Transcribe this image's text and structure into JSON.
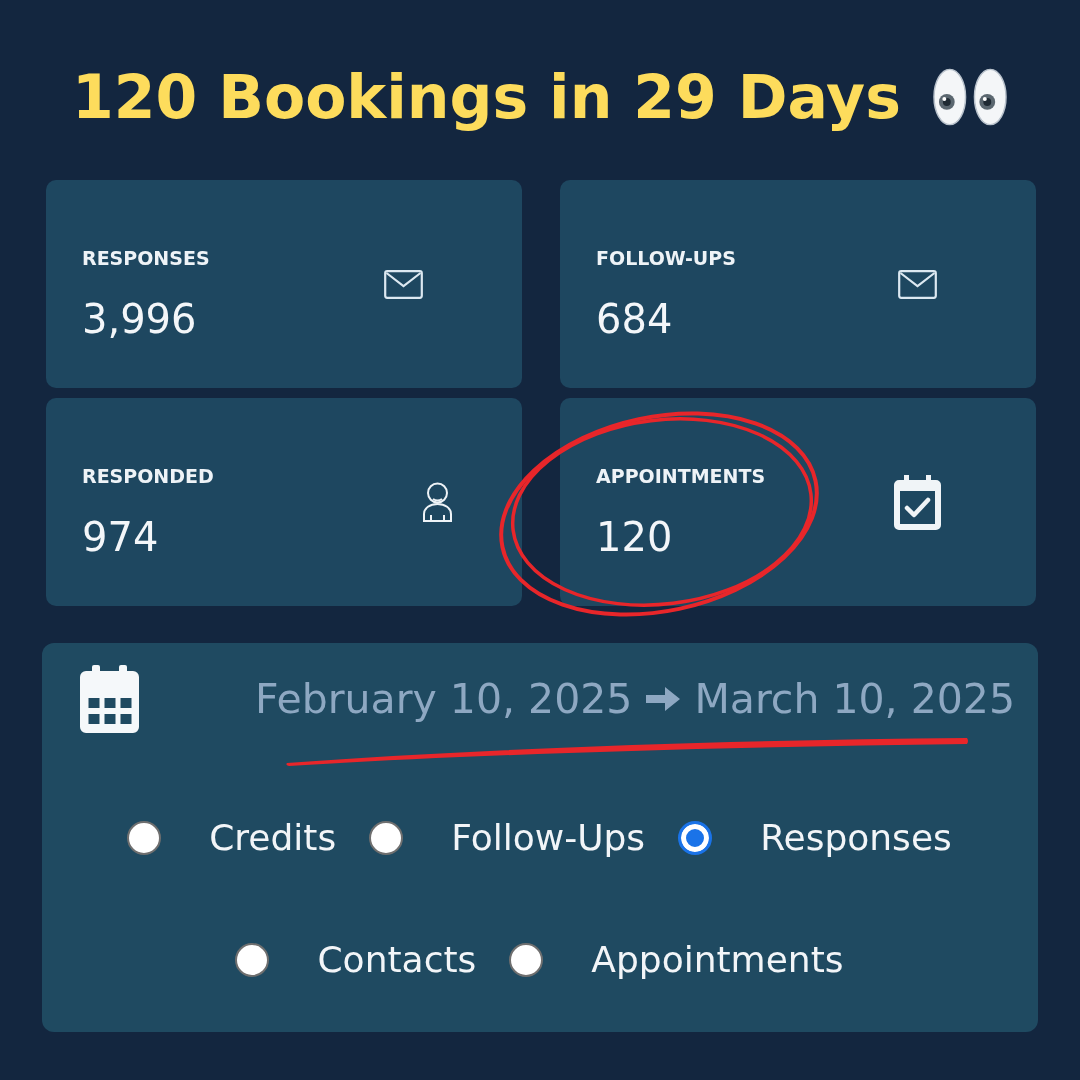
{
  "title": {
    "text": "120 Bookings in 29 Days"
  },
  "stats": [
    {
      "label": "RESPONSES",
      "value": "3,996",
      "circled": false
    },
    {
      "label": "FOLLOW-UPS",
      "value": "684",
      "circled": false
    },
    {
      "label": "RESPONDED",
      "value": "974",
      "circled": false
    },
    {
      "label": "APPOINTMENTS",
      "value": "120",
      "circled": true
    }
  ],
  "date_range": {
    "start": "February 10, 2025",
    "end": "March 10, 2025",
    "underlined": true
  },
  "options": [
    {
      "label": "Credits",
      "selected": false
    },
    {
      "label": "Follow-Ups",
      "selected": false
    },
    {
      "label": "Responses",
      "selected": true
    },
    {
      "label": "Contacts",
      "selected": false
    },
    {
      "label": "Appointments",
      "selected": false
    }
  ]
}
